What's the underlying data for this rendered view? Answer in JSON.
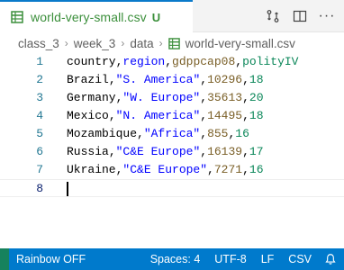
{
  "tab": {
    "title": "world-very-small.csv",
    "status": "U",
    "file_icon": "table-file-icon"
  },
  "actions": {
    "compare_icon": "compare-changes-icon",
    "split_icon": "split-editor-icon",
    "more_label": "···"
  },
  "breadcrumb": {
    "segments": [
      "class_3",
      "week_3",
      "data"
    ],
    "file": "world-very-small.csv",
    "separator": "›"
  },
  "editor": {
    "lines": [
      {
        "num": "1",
        "cells": [
          "country",
          "region",
          "gdppcap08",
          "polityIV"
        ]
      },
      {
        "num": "2",
        "cells": [
          "Brazil",
          "\"S. America\"",
          "10296",
          "18"
        ]
      },
      {
        "num": "3",
        "cells": [
          "Germany",
          "\"W. Europe\"",
          "35613",
          "20"
        ]
      },
      {
        "num": "4",
        "cells": [
          "Mexico",
          "\"N. America\"",
          "14495",
          "18"
        ]
      },
      {
        "num": "5",
        "cells": [
          "Mozambique",
          "\"Africa\"",
          "855",
          "16"
        ]
      },
      {
        "num": "6",
        "cells": [
          "Russia",
          "\"C&E Europe\"",
          "16139",
          "17"
        ]
      },
      {
        "num": "7",
        "cells": [
          "Ukraine",
          "\"C&E Europe\"",
          "7271",
          "16"
        ]
      },
      {
        "num": "8",
        "cells": []
      }
    ],
    "current_line": "8",
    "column_colors": [
      "#000000",
      "#0000ff",
      "#795e26",
      "#098658"
    ]
  },
  "status_bar": {
    "rainbow": "Rainbow OFF",
    "spaces": "Spaces: 4",
    "encoding": "UTF-8",
    "eol": "LF",
    "language": "CSV",
    "bell_icon": "bell-icon"
  }
}
